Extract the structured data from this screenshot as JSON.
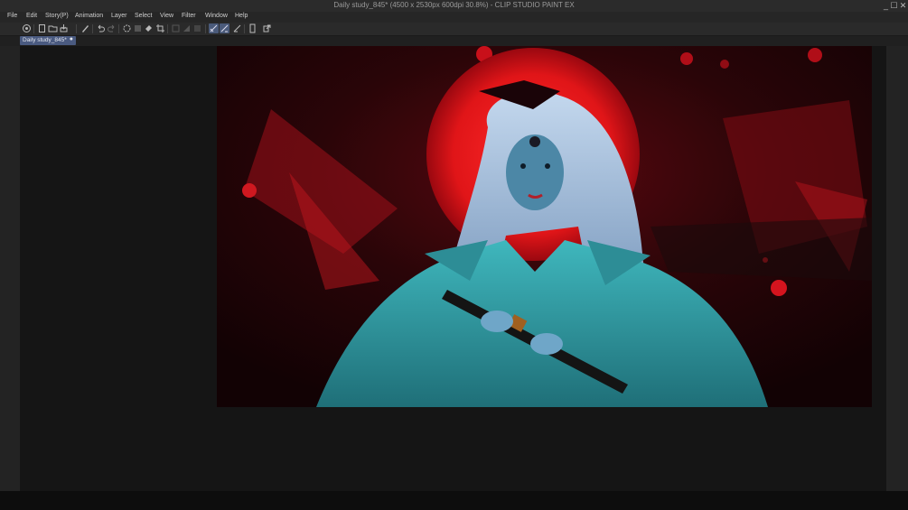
{
  "window": {
    "title": "Daily study_845* (4500 x 2530px 600dpi 30.8%)  - CLIP STUDIO PAINT EX",
    "controls": [
      "_",
      "☐",
      "✕"
    ]
  },
  "menu": [
    "File",
    "Edit",
    "Story(P)",
    "Animation",
    "Layer",
    "Select",
    "View",
    "Filter",
    "Window",
    "Help"
  ],
  "toolbar": {
    "tools": [
      "studio-icon",
      "new-icon",
      "open-icon",
      "save-icon",
      "pen-icon",
      "undo-icon",
      "redo-icon",
      "gear-icon",
      "fill-icon",
      "fill-bucket-icon",
      "crop-icon",
      "transform-icon",
      "ruler-icon",
      "snap-icon",
      "snap-ruler-icon",
      "brush-icon",
      "pencil-icon",
      "eraser-icon",
      "device-icon",
      "share-icon"
    ]
  },
  "document_tab": {
    "label": "Daily study_845*",
    "close": "●"
  },
  "colors": {
    "accent": "#4a5a80",
    "background": "#151515"
  }
}
